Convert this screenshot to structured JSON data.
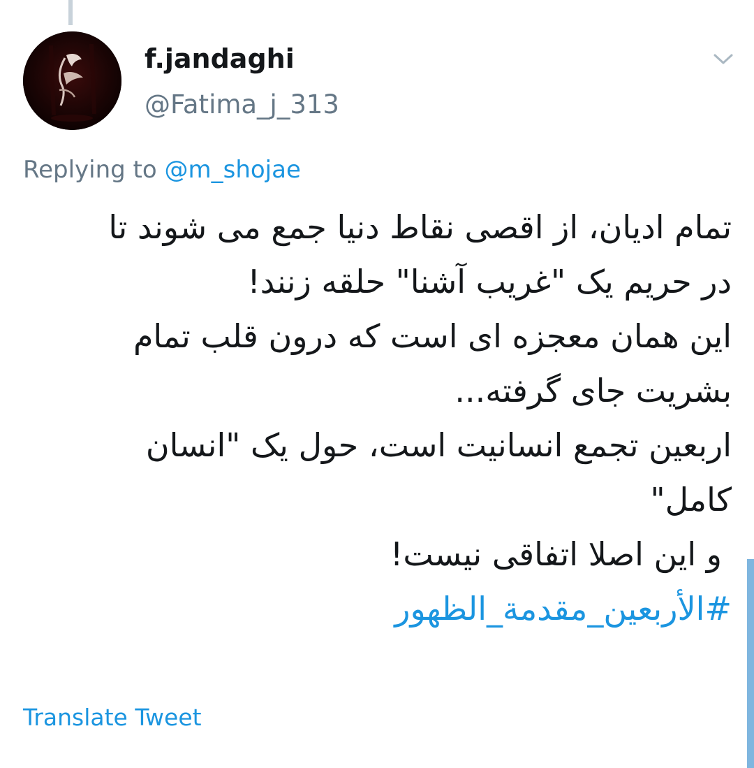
{
  "tweet": {
    "author": {
      "display_name": "f.jandaghi",
      "handle": "@Fatima_j_313",
      "avatar_icon": "calligraphy-bird-avatar"
    },
    "menu_icon": "chevron-down-icon",
    "reply_context": {
      "prefix": "Replying to",
      "mention": "@m_shojae"
    },
    "lines": [
      "تمام ادیان، از اقصی نقاط دنیا جمع می شوند تا",
      "در حریم یک \"غریب آشنا\" حلقه زنند!",
      "این همان معجزه ای است که درون قلب تمام",
      "بشریت جای گرفته...",
      "اربعین تجمع انسانیت است، حول یک \"انسان",
      "کامل\"",
      "و این اصلا اتفاقی نیست!"
    ],
    "hashtag": "#الأربعين_مقدمة_الظهور",
    "translate_label": "Translate Tweet"
  },
  "colors": {
    "text_primary": "#14171a",
    "text_secondary": "#657786",
    "link": "#1b95e0",
    "thread_line": "#c8d2da",
    "scroll_indicator": "#7fb6df",
    "background": "#ffffff"
  }
}
